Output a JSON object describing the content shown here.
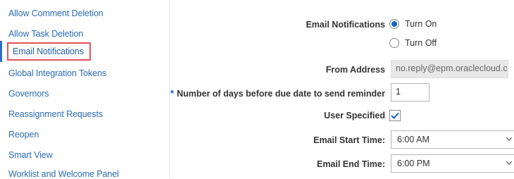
{
  "sidebar": {
    "items": [
      {
        "label": "Allow Comment Deletion"
      },
      {
        "label": "Allow Task Deletion"
      },
      {
        "label": "Email Notifications"
      },
      {
        "label": "Global Integration Tokens"
      },
      {
        "label": "Governors"
      },
      {
        "label": "Reassignment Requests"
      },
      {
        "label": "Reopen"
      },
      {
        "label": "Smart View"
      },
      {
        "label": "Worklist and Welcome Panel"
      }
    ]
  },
  "form": {
    "email_notifications": {
      "label": "Email Notifications",
      "options": [
        {
          "label": "Turn On",
          "selected": true
        },
        {
          "label": "Turn Off",
          "selected": false
        }
      ]
    },
    "from_address": {
      "label": "From Address",
      "value": "no.reply@epm.oraclecloud.com"
    },
    "days_before_due": {
      "required_marker": "*",
      "label": "Number of days before due date to send reminder",
      "value": "1"
    },
    "user_specified": {
      "label": "User Specified",
      "checked": true
    },
    "start_time": {
      "label": "Email Start Time:",
      "value": "6:00 AM"
    },
    "end_time": {
      "label": "Email End Time:",
      "value": "6:00 PM"
    }
  },
  "colors": {
    "link": "#2b6cb3",
    "highlight_border": "#e0535a",
    "radio_selected": "#1a66c2",
    "check": "#1a66c2"
  }
}
